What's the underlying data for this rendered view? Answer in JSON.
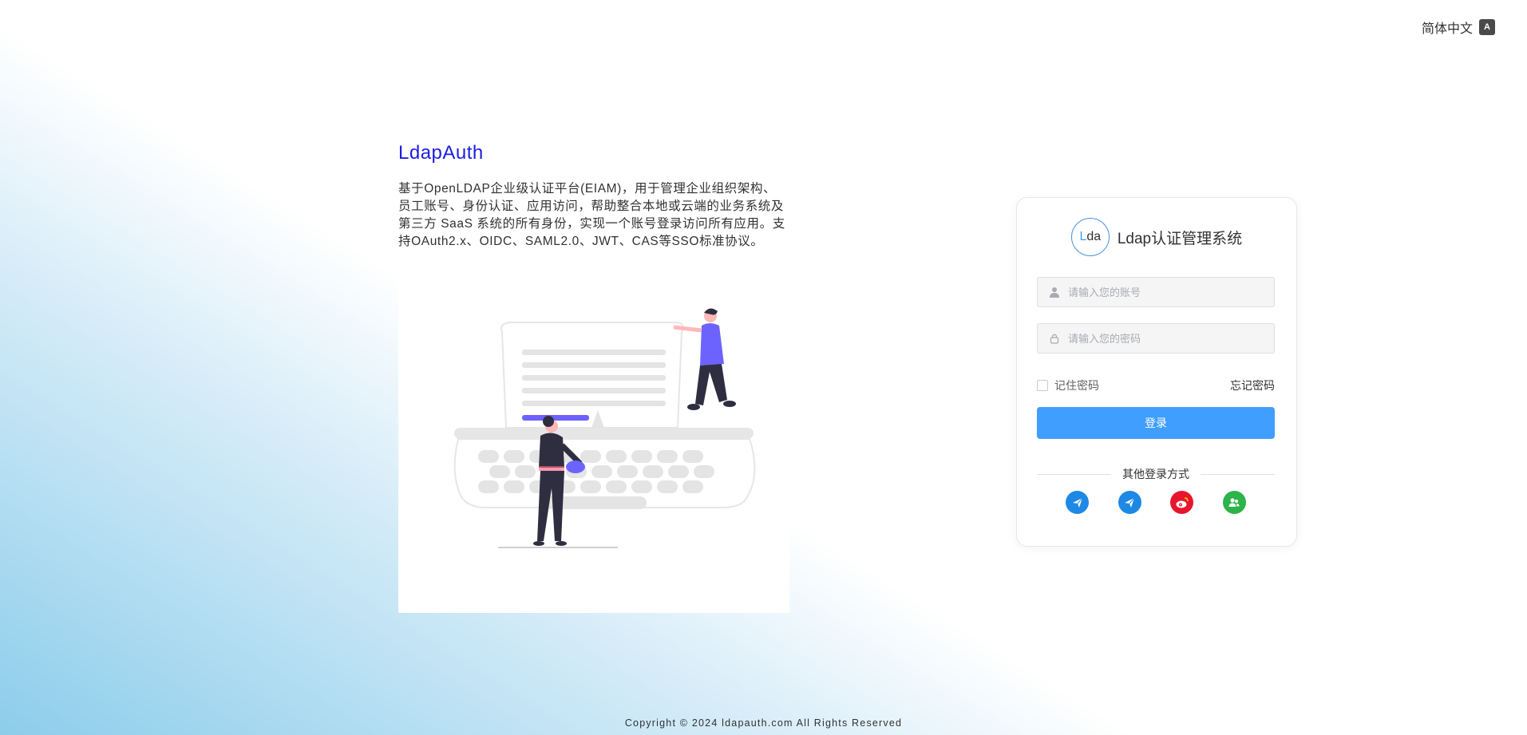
{
  "header": {
    "language_label": "简体中文",
    "language_icon": "translate-icon"
  },
  "intro": {
    "title": "LdapAuth",
    "description": "基于OpenLDAP企业级认证平台(EIAM)，用于管理企业组织架构、员工账号、身份认证、应用访问，帮助整合本地或云端的业务系统及第三方 SaaS 系统的所有身份，实现一个账号登录访问所有应用。支持OAuth2.x、OIDC、SAML2.0、JWT、CAS等SSO标准协议。"
  },
  "login": {
    "logo_first": "L",
    "logo_rest": "da",
    "title": "Ldap认证管理系统",
    "username_placeholder": "请输入您的账号",
    "username_value": "",
    "password_placeholder": "请输入您的密码",
    "password_value": "",
    "remember_label": "记住密码",
    "remember_checked": false,
    "forgot_label": "忘记密码",
    "submit_label": "登录",
    "other_methods_label": "其他登录方式",
    "providers": [
      {
        "name": "feishu-icon",
        "color": "#1e88e5"
      },
      {
        "name": "feishu-icon",
        "color": "#1e88e5"
      },
      {
        "name": "weibo-icon",
        "color": "#e6162d"
      },
      {
        "name": "contact-icon",
        "color": "#2cb34a"
      }
    ]
  },
  "footer": {
    "copyright": "Copyright © 2024 ldapauth.com All Rights Reserved"
  },
  "colors": {
    "primary": "#409eff",
    "title_blue": "#1d1de0",
    "illustration_accent": "#6c63ff"
  }
}
